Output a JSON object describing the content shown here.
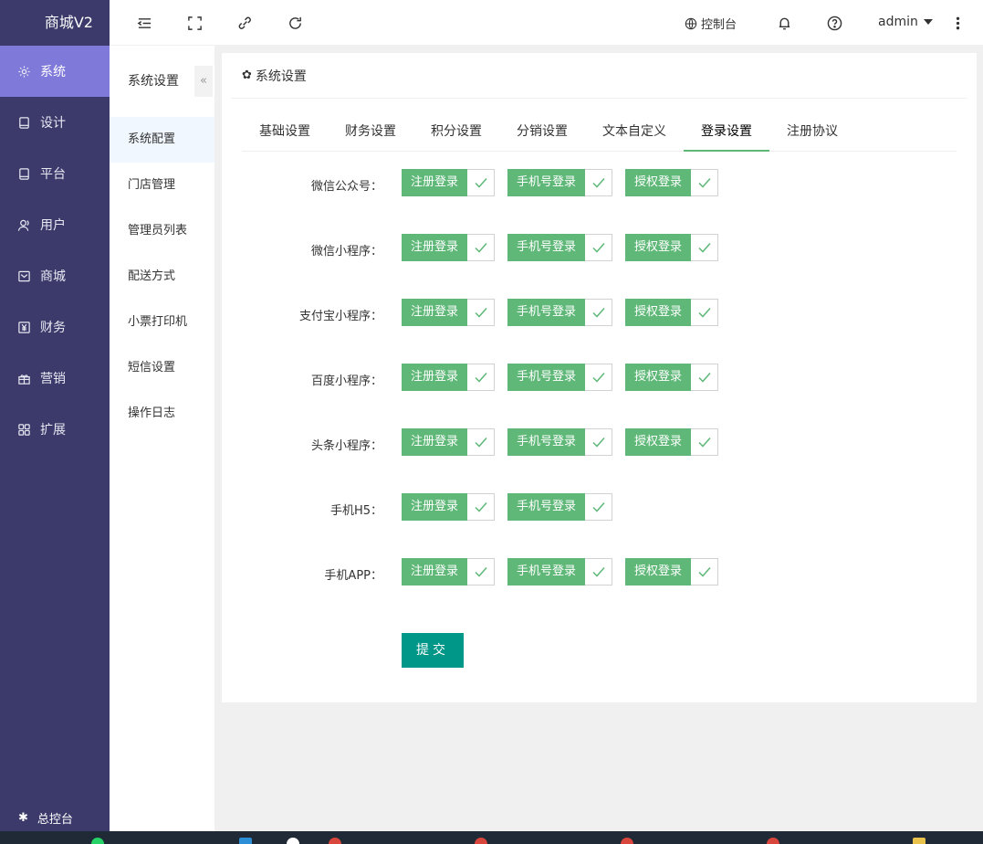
{
  "nav": {
    "logo": "商城V2",
    "items": [
      {
        "label": "系统",
        "icon": "gear-icon",
        "active": true
      },
      {
        "label": "设计",
        "icon": "tablet-icon"
      },
      {
        "label": "平台",
        "icon": "tablet-icon"
      },
      {
        "label": "用户",
        "icon": "user-icon"
      },
      {
        "label": "商城",
        "icon": "mail-icon"
      },
      {
        "label": "财务",
        "icon": "yen-icon"
      },
      {
        "label": "营销",
        "icon": "gift-icon"
      },
      {
        "label": "扩展",
        "icon": "grid-icon"
      }
    ],
    "bottom": "总控台"
  },
  "topbar": {
    "console": "控制台",
    "user": "admin"
  },
  "submenu": {
    "title": "系统设置",
    "collapse": "«",
    "items": [
      "系统配置",
      "门店管理",
      "管理员列表",
      "配送方式",
      "小票打印机",
      "短信设置",
      "操作日志"
    ]
  },
  "card": {
    "title": "系统设置",
    "tabs": [
      "基础设置",
      "财务设置",
      "积分设置",
      "分销设置",
      "文本自定义",
      "登录设置",
      "注册协议"
    ],
    "rows": [
      {
        "label": "微信公众号：",
        "options": [
          "注册登录",
          "手机号登录",
          "授权登录"
        ]
      },
      {
        "label": "微信小程序：",
        "options": [
          "注册登录",
          "手机号登录",
          "授权登录"
        ]
      },
      {
        "label": "支付宝小程序：",
        "options": [
          "注册登录",
          "手机号登录",
          "授权登录"
        ]
      },
      {
        "label": "百度小程序：",
        "options": [
          "注册登录",
          "手机号登录",
          "授权登录"
        ]
      },
      {
        "label": "头条小程序：",
        "options": [
          "注册登录",
          "手机号登录",
          "授权登录"
        ]
      },
      {
        "label": "手机H5：",
        "options": [
          "注册登录",
          "手机号登录"
        ]
      },
      {
        "label": "手机APP：",
        "options": [
          "注册登录",
          "手机号登录",
          "授权登录"
        ]
      }
    ],
    "submit": "提交"
  },
  "colors": {
    "nav_bg": "#3b3a6b",
    "nav_active": "#7f79d9",
    "check_green": "#5fb878",
    "submit": "#009688"
  }
}
